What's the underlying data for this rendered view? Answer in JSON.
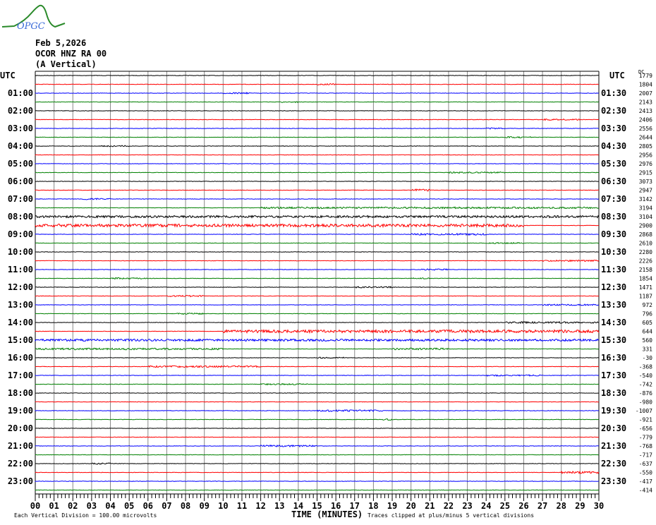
{
  "header": {
    "logo_text": "OPGC",
    "date": "Feb 5,2026",
    "station": "OCOR HNZ RA 00",
    "component": "(A Vertical)"
  },
  "footer": {
    "scale_note": "Each Vertical Division =  100.00 microvolts",
    "xlabel": "TIME (MINUTES)",
    "clip_note": "Traces clipped at plus/minus 5 vertical divisions"
  },
  "chart_data": {
    "type": "line",
    "title": "Feb 5,2026 OCOR HNZ RA 00 (A Vertical)",
    "xlabel": "TIME (MINUTES)",
    "xlim": [
      0,
      30
    ],
    "x_ticks": [
      "00",
      "01",
      "02",
      "03",
      "04",
      "05",
      "06",
      "07",
      "08",
      "09",
      "10",
      "11",
      "12",
      "13",
      "14",
      "15",
      "16",
      "17",
      "18",
      "19",
      "20",
      "21",
      "22",
      "23",
      "24",
      "25",
      "26",
      "27",
      "28",
      "29",
      "30"
    ],
    "left_label": "UTC",
    "right_label": "UTC",
    "dc_label": "DC",
    "left_hours": [
      "01:00",
      "02:00",
      "03:00",
      "04:00",
      "05:00",
      "06:00",
      "07:00",
      "08:00",
      "09:00",
      "10:00",
      "11:00",
      "12:00",
      "13:00",
      "14:00",
      "15:00",
      "16:00",
      "17:00",
      "18:00",
      "19:00",
      "20:00",
      "21:00",
      "22:00",
      "23:00"
    ],
    "right_hours": [
      "01:30",
      "02:30",
      "03:30",
      "04:30",
      "05:30",
      "06:30",
      "07:30",
      "08:30",
      "09:30",
      "10:30",
      "11:30",
      "12:30",
      "13:30",
      "14:30",
      "15:30",
      "16:30",
      "17:30",
      "18:30",
      "19:30",
      "20:30",
      "21:30",
      "22:30",
      "23:30"
    ],
    "dc_offsets": [
      "1779",
      "1804",
      "2007",
      "2143",
      "2413",
      "2406",
      "2556",
      "2644",
      "2805",
      "2956",
      "2976",
      "2915",
      "3073",
      "2947",
      "3142",
      "3194",
      "3104",
      "2900",
      "2868",
      "2610",
      "2280",
      "2226",
      "2158",
      "1854",
      "1471",
      "1187",
      "972",
      "796",
      "605",
      "644",
      "560",
      "331",
      "-30",
      "-368",
      "-540",
      "-742",
      "-876",
      "-980",
      "-1007",
      "-921",
      "-656",
      "-779",
      "-768",
      "-717",
      "-637",
      "-550",
      "-417",
      "-414"
    ],
    "trace_colors": [
      "#000000",
      "#ff0000",
      "#0000ff",
      "#008000"
    ],
    "activity": [
      [
        1,
        15,
        16,
        1
      ],
      [
        2,
        10,
        11.5,
        1
      ],
      [
        3,
        13,
        14,
        1
      ],
      [
        5,
        27,
        29,
        1
      ],
      [
        6,
        24,
        25,
        1
      ],
      [
        7,
        25,
        26.5,
        1
      ],
      [
        8,
        3.5,
        5,
        1
      ],
      [
        11,
        22,
        25,
        1
      ],
      [
        13,
        20,
        21,
        1.5
      ],
      [
        14,
        2.5,
        4,
        1
      ],
      [
        15,
        12,
        30,
        1.2
      ],
      [
        16,
        0,
        30,
        1.5
      ],
      [
        17,
        0,
        26,
        2
      ],
      [
        18,
        20,
        24,
        1.2
      ],
      [
        19,
        24,
        26,
        1
      ],
      [
        21,
        27,
        30,
        1
      ],
      [
        22,
        20.5,
        22,
        1
      ],
      [
        23,
        4,
        6,
        1
      ],
      [
        23,
        20,
        21,
        1
      ],
      [
        24,
        17,
        19,
        1
      ],
      [
        25,
        7,
        9,
        1
      ],
      [
        26,
        27,
        30,
        1
      ],
      [
        27,
        7.5,
        9,
        1
      ],
      [
        28,
        25,
        30,
        1.2
      ],
      [
        29,
        10,
        30,
        2
      ],
      [
        30,
        0,
        30,
        1.5
      ],
      [
        31,
        0,
        10,
        1.2
      ],
      [
        31,
        19,
        22,
        1.2
      ],
      [
        32,
        15,
        16.5,
        1
      ],
      [
        33,
        6,
        12,
        1.2
      ],
      [
        34,
        24,
        27,
        1
      ],
      [
        35,
        12,
        14.5,
        1
      ],
      [
        38,
        15,
        18.5,
        1.2
      ],
      [
        39,
        18.5,
        19,
        1
      ],
      [
        42,
        12,
        15,
        1.2
      ],
      [
        44,
        3,
        4,
        1
      ],
      [
        45,
        28,
        30,
        1.5
      ]
    ]
  }
}
